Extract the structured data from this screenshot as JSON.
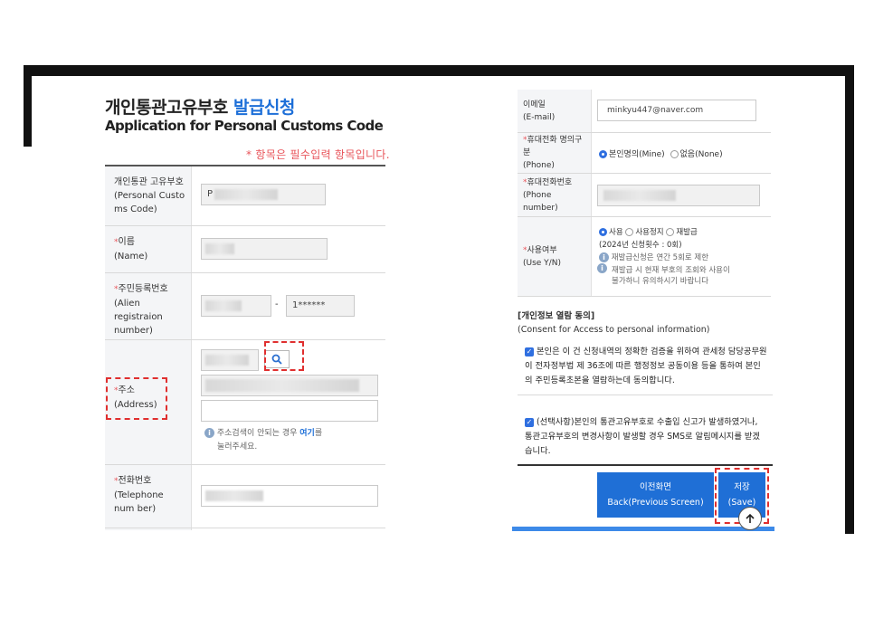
{
  "left": {
    "title_ko": "개인통관고유부호",
    "title_ko_accent": "발급신청",
    "title_en": "Application for Personal Customs Code",
    "required_note": "* 항목은 필수입력 항목입니다.",
    "rows": {
      "customs_code": {
        "label_ko": "개인통관 고유부호",
        "label_en": "(Personal Custo ms Code)",
        "value": "P"
      },
      "name": {
        "label_ko": "이름",
        "label_en": "(Name)"
      },
      "resident_no": {
        "label_ko": "주민등록번호",
        "label_en": "(Alien registraion number)",
        "separator": "-",
        "value_back": "1******"
      },
      "address": {
        "label_ko": "주소",
        "label_en": "(Address)",
        "note_1": "주소검색이 안되는 경우 ",
        "note_link": "여기",
        "note_2": "를",
        "note_3": "눌러주세요."
      },
      "telephone": {
        "label_ko": "전화번호",
        "label_en": "(Telephone num ber)"
      }
    }
  },
  "right": {
    "email": {
      "label_ko": "이메일",
      "label_en": "(E-mail)",
      "value": "minkyu447@naver.com"
    },
    "phone_owner": {
      "label_ko": "휴대전화 명의구분",
      "label_en": "(Phone)",
      "option_1": "본인명의(Mine)",
      "option_2": "없음(None)"
    },
    "phone_number": {
      "label_ko": "휴대전화번호",
      "label_en": "(Phone number)"
    },
    "use_yn": {
      "label_ko": "사용여부",
      "label_en": "(Use Y/N)",
      "opt_use": "사용",
      "opt_suspend": "사용정지",
      "opt_reissue": "재발급",
      "count_note": "(2024년 신청횟수 : 0회)",
      "info_1": "재발급신청은 연간 5회로 제한",
      "info_2a": "재발급 시 현재 부호의 조회와 사용이",
      "info_2b": "불가하니 유의하시기 바랍니다"
    },
    "consent_head_ko": "[개인정보 열람 동의]",
    "consent_head_en": "(Consent for Access to personal information)",
    "consent_1": "본인은 이 건 신청내역의 정확한 검증을 위하여 관세청 담당공무원이 전자정부법 제 36조에 따른 행정정보 공동이용 등을 통하여 본인의 주민등록초본을 열람하는데 동의합니다.",
    "consent_2": "(선택사항)본인의 통관고유부호로 수출입 신고가 발생하였거나, 통관고유부호의 변경사항이 발생할 경우 SMS로 알림메시지를 받겠습니다.",
    "btn_prev_ko": "이전화면",
    "btn_prev_en": "Back(Previous Screen)",
    "btn_save_ko": "저장",
    "btn_save_en": "(Save)"
  },
  "colors": {
    "accent": "#1d6fd8",
    "required": "#e8545a",
    "button": "#1f6fd6",
    "highlight_box": "#e02f2f"
  }
}
